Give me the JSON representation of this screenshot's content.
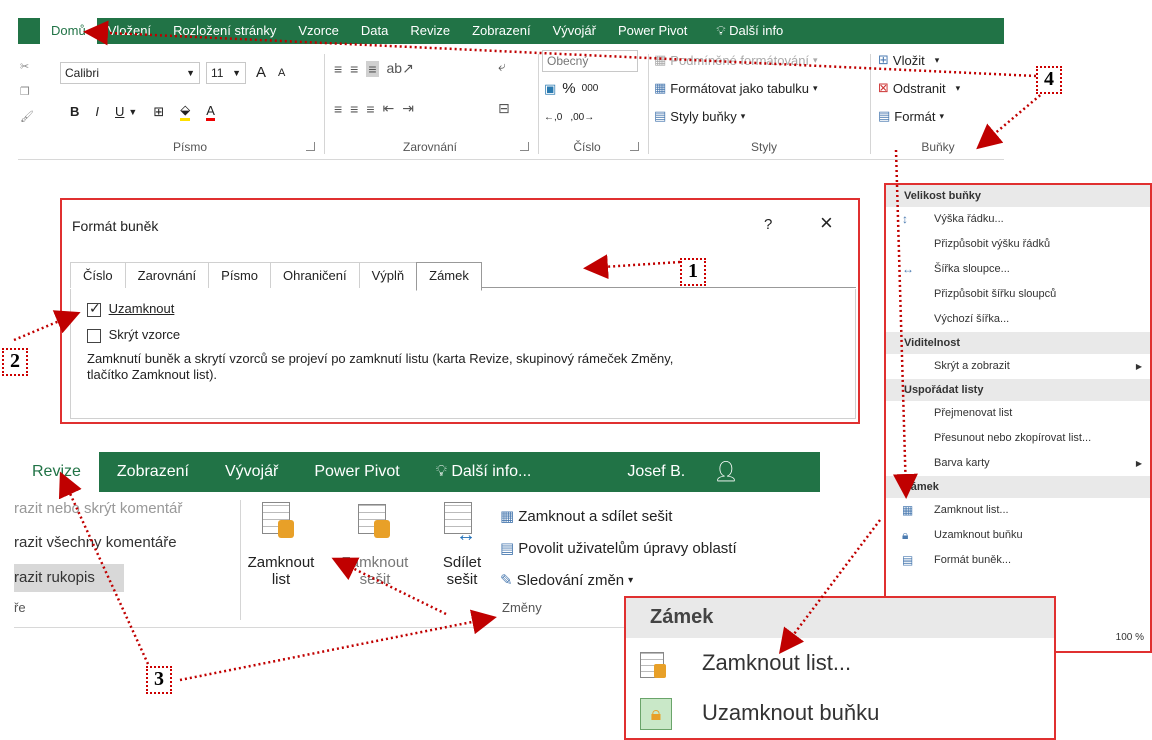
{
  "top_ribbon": {
    "tabs": [
      "Domů",
      "Vložení",
      "Rozložení stránky",
      "Vzorce",
      "Data",
      "Revize",
      "Zobrazení",
      "Vývojář",
      "Power Pivot"
    ],
    "tell_me": "Další info",
    "font": {
      "name": "Calibri",
      "size": "11",
      "grow": "A",
      "shrink": "A",
      "bold": "B",
      "italic": "I",
      "underline": "U",
      "group_label": "Písmo"
    },
    "alignment_label": "Zarovnání",
    "number": {
      "format": "Obecný",
      "percent": "%",
      "thousands": "000",
      "group_label": "Číslo"
    },
    "styles": {
      "conditional": "Podmíněné formátování",
      "as_table": "Formátovat jako tabulku",
      "cell_styles": "Styly buňky",
      "group_label": "Styly"
    },
    "cells": {
      "insert": "Vložit",
      "delete": "Odstranit",
      "format": "Formát",
      "group_label": "Buňky"
    }
  },
  "dialog": {
    "title": "Formát buněk",
    "help": "?",
    "close": "×",
    "tabs": [
      "Číslo",
      "Zarovnání",
      "Písmo",
      "Ohraničení",
      "Výplň",
      "Zámek"
    ],
    "lock_label": "Uzamknout",
    "lock_checked": true,
    "hide_label": "Skrýt vzorce",
    "hide_checked": false,
    "note_line1": "Zamknutí buněk a skrytí vzorců se projeví po zamknutí listu (karta Revize, skupinový rámeček Změny,",
    "note_line2": "tlačítko Zamknout list)."
  },
  "rev_ribbon": {
    "tabs": [
      "Revize",
      "Zobrazení",
      "Vývojář",
      "Power Pivot"
    ],
    "tell_me": "Další info...",
    "user": "Josef B.",
    "share_icon": "share-person-icon",
    "comments": [
      "razit nebo skrýt komentář",
      "razit všechny komentáře",
      "razit rukopis"
    ],
    "comments_group": "ře",
    "lock_sheet": [
      "Zamknout",
      "list"
    ],
    "lock_workbook": [
      "Zamknout",
      "sešit"
    ],
    "share_workbook": [
      "Sdílet",
      "sešit"
    ],
    "protect_share": "Zamknout a sdílet sešit",
    "allow_edit": "Povolit uživatelům úpravy oblastí",
    "track_changes": "Sledování změn",
    "group_label": "Změny"
  },
  "context_menu": {
    "sections": [
      {
        "header": "Velikost buňky",
        "items": [
          {
            "label": "Výška řádku...",
            "icon": "row-height-icon"
          },
          {
            "label": "Přizpůsobit výšku řádků"
          },
          {
            "label": "Šířka sloupce...",
            "icon": "col-width-icon"
          },
          {
            "label": "Přizpůsobit šířku sloupců"
          },
          {
            "label": "Výchozí šířka..."
          }
        ]
      },
      {
        "header": "Viditelnost",
        "items": [
          {
            "label": "Skrýt a zobrazit",
            "submenu": true
          }
        ]
      },
      {
        "header": "Uspořádat listy",
        "items": [
          {
            "label": "Přejmenovat list"
          },
          {
            "label": "Přesunout nebo zkopírovat list..."
          },
          {
            "label": "Barva karty",
            "submenu": true
          }
        ]
      },
      {
        "header": "Zámek",
        "items": [
          {
            "label": "Zamknout list...",
            "icon": "lock-sheet-icon"
          },
          {
            "label": "Uzamknout buňku",
            "icon": "lock-icon"
          },
          {
            "label": "Formát buněk...",
            "icon": "format-cells-icon"
          }
        ]
      }
    ],
    "zoom": "100 %"
  },
  "zoom_popup": {
    "header": "Zámek",
    "item1": "Zamknout list...",
    "item2": "Uzamknout buňku"
  },
  "markers": [
    "1",
    "2",
    "3",
    "4"
  ],
  "colors": {
    "excel_green": "#217346",
    "highlight_red": "#e03030",
    "arrow_red": "#c00000"
  }
}
